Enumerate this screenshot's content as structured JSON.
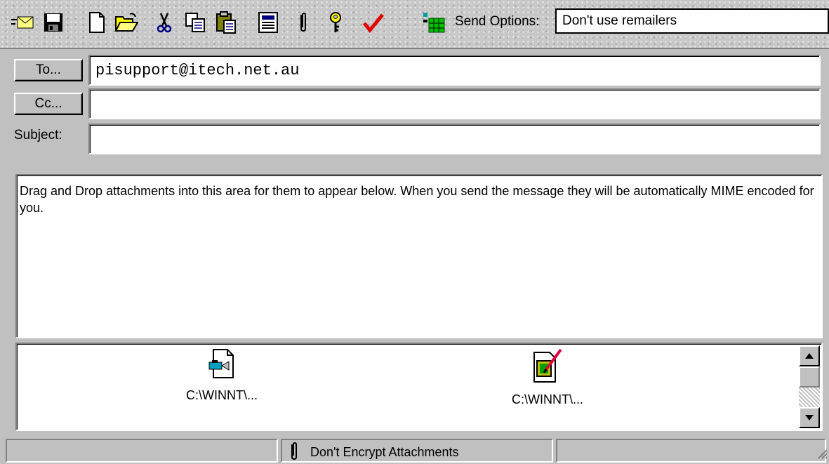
{
  "toolbar": {
    "icons": [
      "envelope-icon",
      "save-icon",
      "new-document-icon",
      "open-folder-icon",
      "cut-icon",
      "copy-icon",
      "paste-icon",
      "address-book-icon",
      "paperclip-icon",
      "key-icon",
      "check-icon",
      "grid-icon"
    ],
    "send_options_label": "Send Options:",
    "send_options_value": "Don't use remailers"
  },
  "header": {
    "to_button": "To...",
    "cc_button": "Cc...",
    "subject_label": "Subject:",
    "to_value": "pisupport@itech.net.au",
    "cc_value": "",
    "subject_value": ""
  },
  "body": {
    "text": "Drag and Drop attachments into this area for them to appear below.  When you send the message they will be automatically MIME encoded for you."
  },
  "attachments": [
    {
      "icon": "video-file-icon",
      "name": "C:\\WINNT\\..."
    },
    {
      "icon": "image-file-icon",
      "name": "C:\\WINNT\\..."
    }
  ],
  "status": {
    "encrypt_attachments": "Don't Encrypt Attachments"
  },
  "colors": {
    "chrome": "#c0c0c0",
    "field_bg": "#ffffff",
    "accent_red": "#e00000",
    "accent_green": "#00a000"
  }
}
